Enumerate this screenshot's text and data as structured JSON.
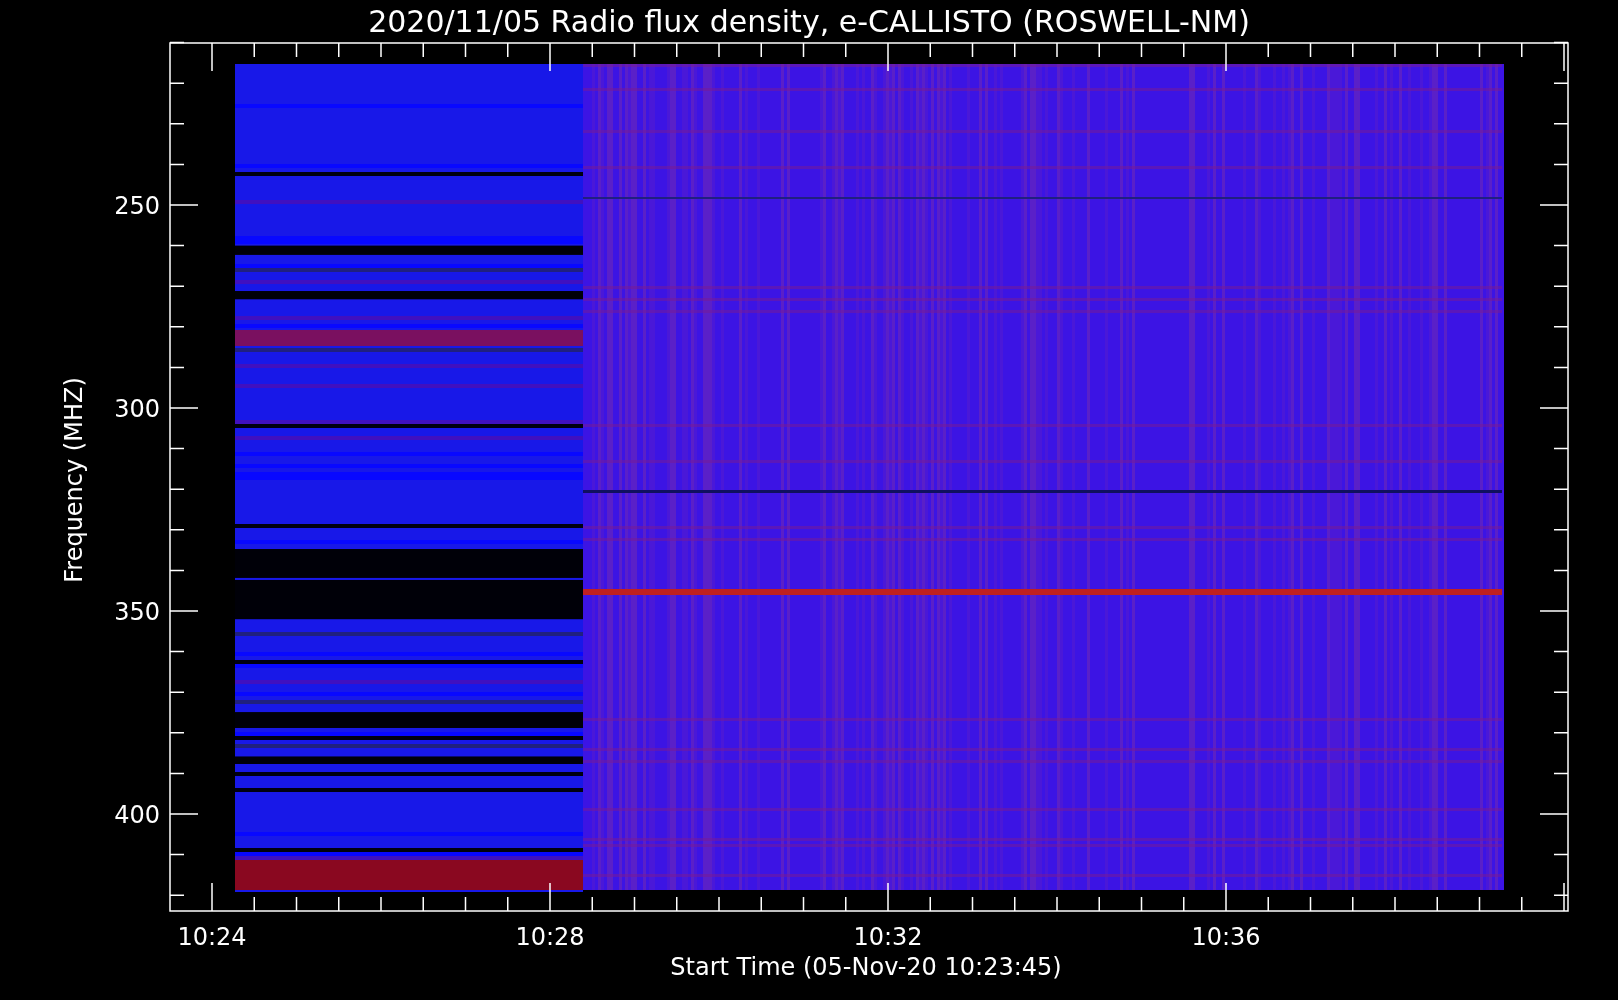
{
  "title": "2020/11/05  Radio flux density, e-CALLISTO (ROSWELL-NM)",
  "y_axis": {
    "label": "Frequency (MHZ)",
    "ticks": [
      "250",
      "300",
      "350",
      "400"
    ]
  },
  "x_axis": {
    "label": "Start Time (05-Nov-20 10:23:45)",
    "ticks": [
      "10:24",
      "10:28",
      "10:32",
      "10:36"
    ]
  }
}
